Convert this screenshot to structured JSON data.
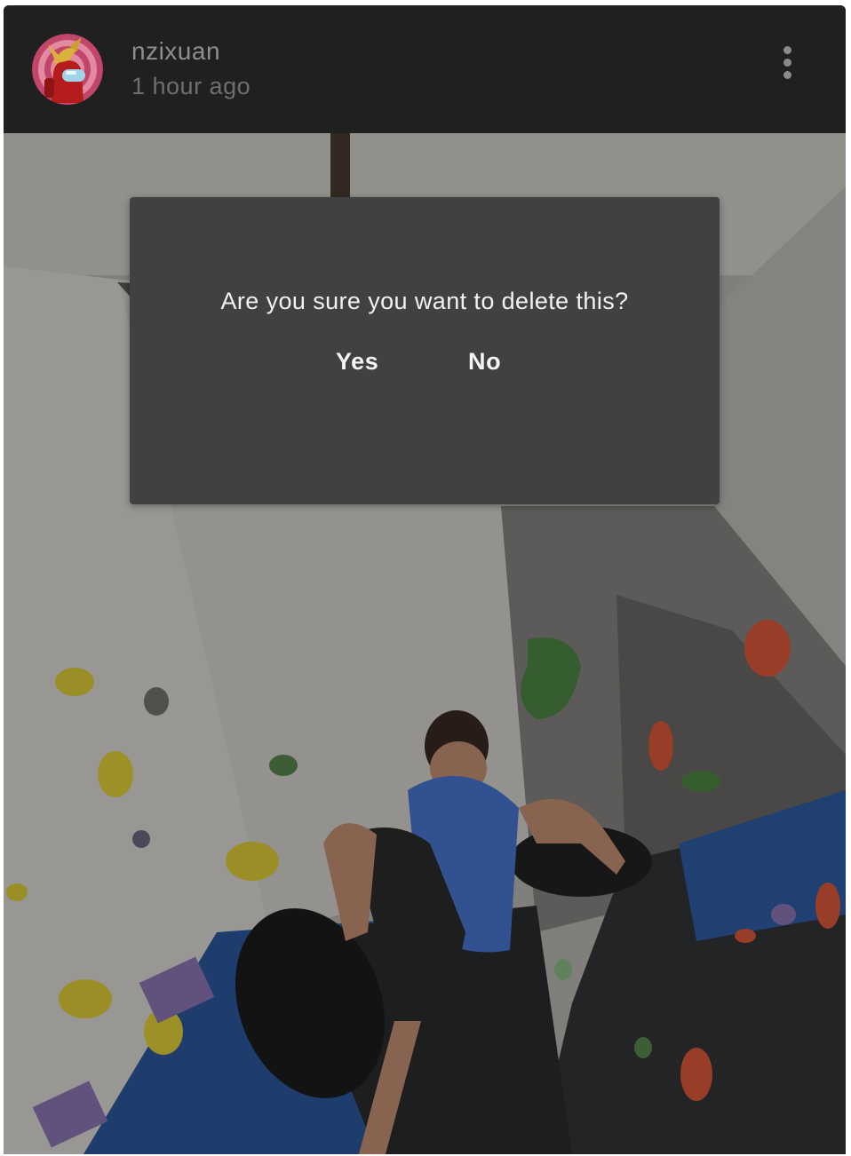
{
  "post": {
    "username": "nzixuan",
    "timestamp": "1 hour ago",
    "avatar_icon": "crewmate-avatar-icon",
    "menu_icon": "more-vertical-icon"
  },
  "dialog": {
    "message": "Are you sure you want to delete this?",
    "confirm_label": "Yes",
    "cancel_label": "No"
  },
  "colors": {
    "card_background": "#202020",
    "dialog_background": "#414141",
    "dialog_text": "#f2f2f2",
    "username_text": "#8e8e8e"
  }
}
